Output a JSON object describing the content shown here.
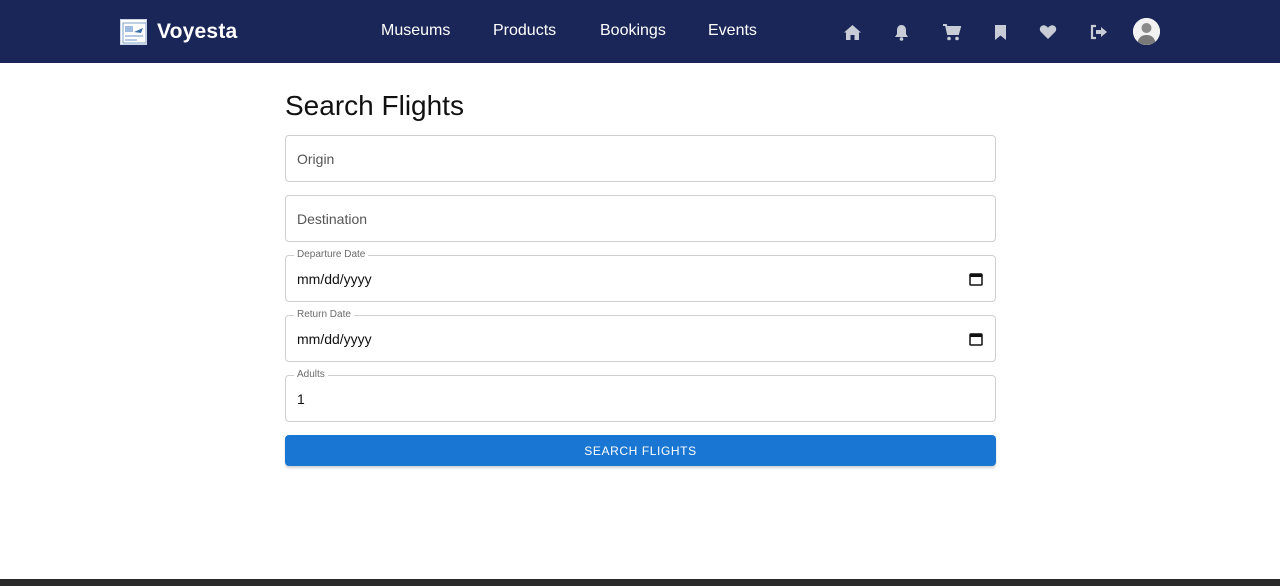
{
  "brand": {
    "name": "Voyesta",
    "logo_icon": "voyesta-logo-icon"
  },
  "nav": {
    "links": [
      {
        "label": "Museums"
      },
      {
        "label": "Products"
      },
      {
        "label": "Bookings"
      },
      {
        "label": "Events"
      }
    ],
    "icons": [
      "home-icon",
      "bell-icon",
      "cart-icon",
      "bookmark-icon",
      "heart-icon",
      "logout-icon",
      "avatar"
    ]
  },
  "page": {
    "title": "Search Flights",
    "form": {
      "origin_placeholder": "Origin",
      "destination_placeholder": "Destination",
      "departure_label": "Departure Date",
      "departure_value": "mm/dd/yyyy",
      "return_label": "Return Date",
      "return_value": "mm/dd/yyyy",
      "adults_label": "Adults",
      "adults_value": "1",
      "submit_label": "SEARCH FLIGHTS"
    }
  },
  "colors": {
    "navbar": "#1a2657",
    "primary_button": "#1976d2",
    "icon_grey": "#c8ccd6"
  }
}
